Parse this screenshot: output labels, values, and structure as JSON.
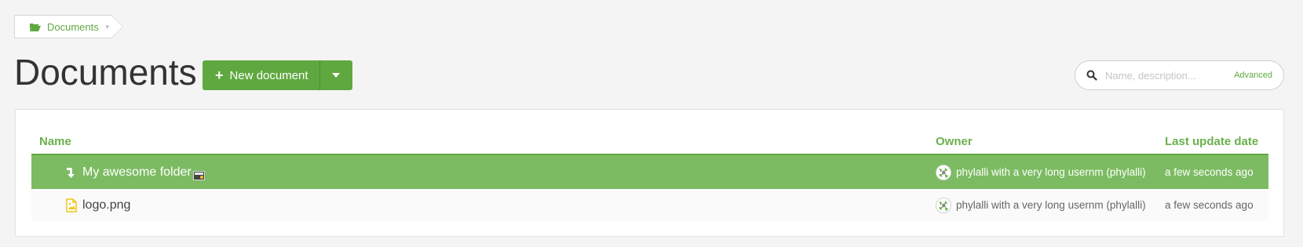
{
  "breadcrumb": {
    "label": "Documents"
  },
  "header": {
    "title": "Documents",
    "new_document_label": "New document"
  },
  "search": {
    "placeholder": "Name, description...",
    "advanced_label": "Advanced"
  },
  "table": {
    "columns": {
      "name": "Name",
      "owner": "Owner",
      "date": "Last update date"
    },
    "rows": [
      {
        "name": "My awesome folder",
        "type": "folder",
        "owner": "phylalli with a very long usernm (phylalli)",
        "date": "a few seconds ago",
        "selected": true
      },
      {
        "name": "logo.png",
        "type": "image",
        "owner": "phylalli with a very long usernm (phylalli)",
        "date": "a few seconds ago",
        "selected": false
      }
    ]
  },
  "colors": {
    "accent": "#5fa840",
    "selected_row": "#7cbb62",
    "image_icon": "#f0c419"
  },
  "icons": {
    "breadcrumb": "folder-open-icon",
    "new_button": "plus-icon",
    "dropdown": "chevron-down-icon",
    "search": "search-icon",
    "folder_row": "folder-arrow-icon",
    "image_row": "image-file-icon",
    "shared": "share-icon"
  }
}
